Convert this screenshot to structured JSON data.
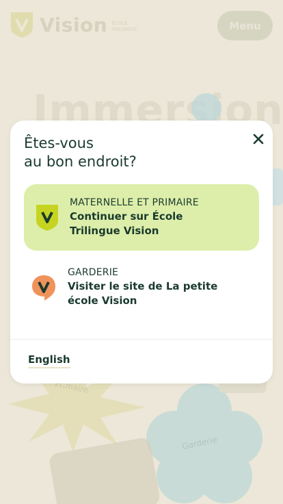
{
  "header": {
    "brand_name": "Vision",
    "brand_sub_line1": "ÉCOLE",
    "brand_sub_line2": "TRILINGUE",
    "menu_label": "Menu"
  },
  "hero": {
    "headline": "Immersion"
  },
  "background": {
    "label_primaire": "Primaire",
    "label_garderie": "Garderie"
  },
  "modal": {
    "title_line1": "Êtes-vous",
    "title_line2": "au bon endroit?",
    "options": [
      {
        "category": "MATERNELLE ET PRIMAIRE",
        "label": "Continuer sur École Trilingue Vision",
        "icon": "vision-green-shield-icon"
      },
      {
        "category": "GARDERIE",
        "label": "Visiter le site de La petite école Vision",
        "icon": "vision-orange-bubble-icon"
      }
    ],
    "language_link": "English"
  },
  "colors": {
    "background": "#f4efe0",
    "modal_bg": "#ffffff",
    "primary_option_bg": "#ddeeaa",
    "text_dark": "#1a3a2e",
    "brand_green": "#c6d421",
    "brand_orange": "#f0935a"
  }
}
